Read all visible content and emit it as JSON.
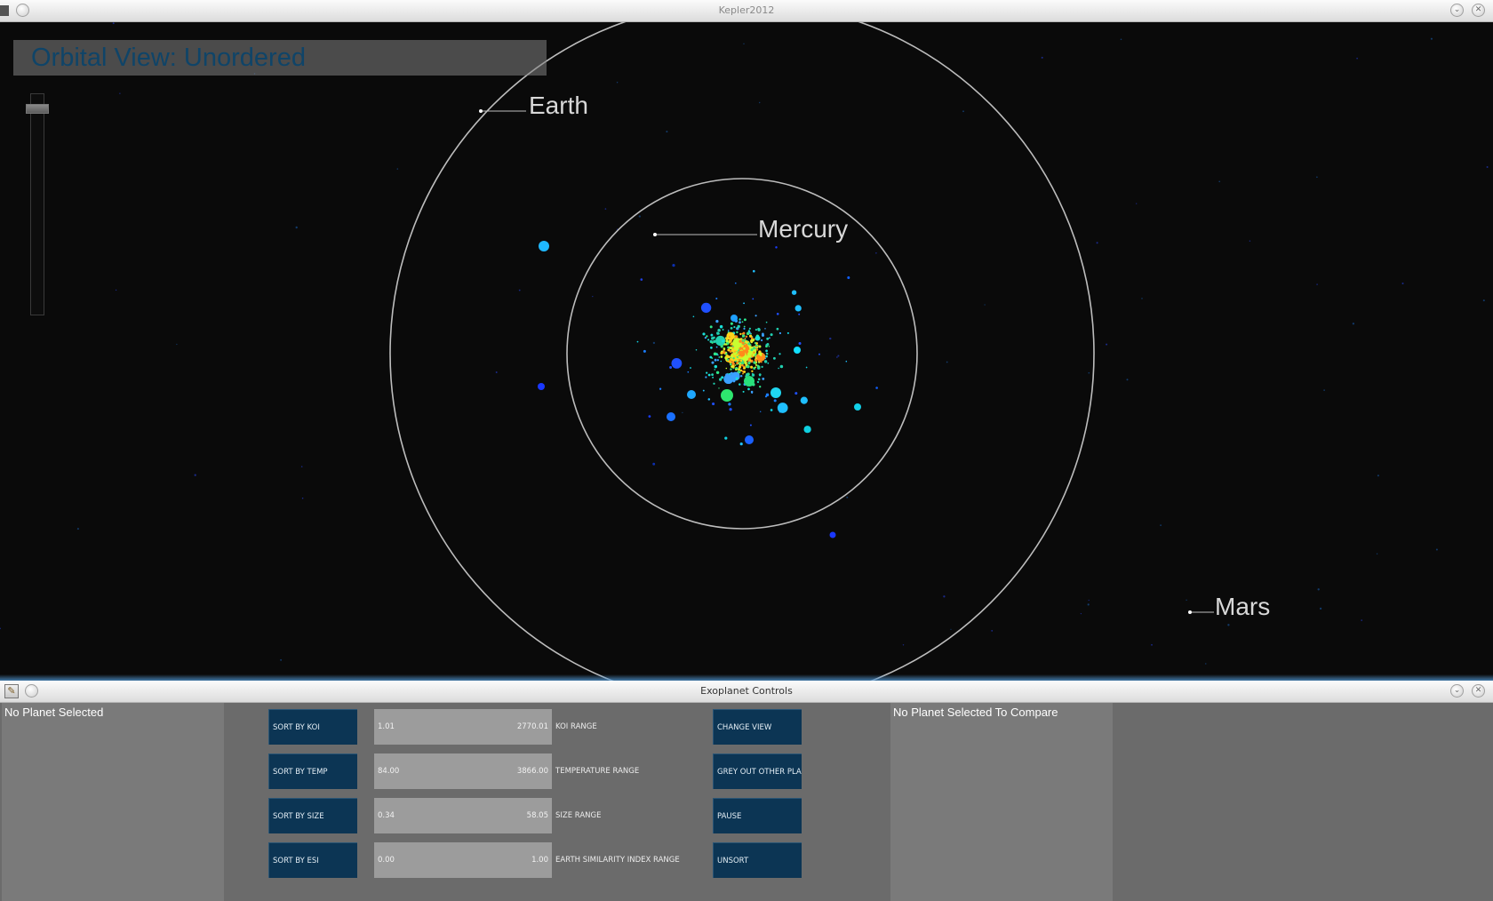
{
  "main_window": {
    "title": "Kepler2012",
    "view_title": "Orbital View: Unordered",
    "zoom_level": 0.05,
    "orbits": [
      {
        "planet": "Mercury"
      },
      {
        "planet": "Earth"
      },
      {
        "planet": "Mars"
      }
    ],
    "background_color": "#0a0a0a",
    "orbit_color": "#bdbdbd"
  },
  "controls_window": {
    "title": "Exoplanet Controls",
    "left_panel_text": "No Planet Selected",
    "right_panel_text": "No Planet Selected To Compare",
    "button_color": "#0c3554",
    "sort_buttons": [
      "SORT BY KOI",
      "SORT BY TEMP",
      "SORT BY SIZE",
      "SORT BY ESI"
    ],
    "ranges": [
      {
        "min": "1.01",
        "max": "2770.01",
        "label": "KOI RANGE"
      },
      {
        "min": "84.00",
        "max": "3866.00",
        "label": "TEMPERATURE RANGE"
      },
      {
        "min": "0.34",
        "max": "58.05",
        "label": "SIZE RANGE"
      },
      {
        "min": "0.00",
        "max": "1.00",
        "label": "EARTH SIMILARITY INDEX RANGE"
      }
    ],
    "action_buttons": [
      "CHANGE VIEW",
      "GREY OUT OTHER PLANETS",
      "PAUSE",
      "UNSORT"
    ]
  },
  "icons": [
    "window-menu-icon",
    "minimize-icon",
    "close-icon",
    "app-icon"
  ]
}
